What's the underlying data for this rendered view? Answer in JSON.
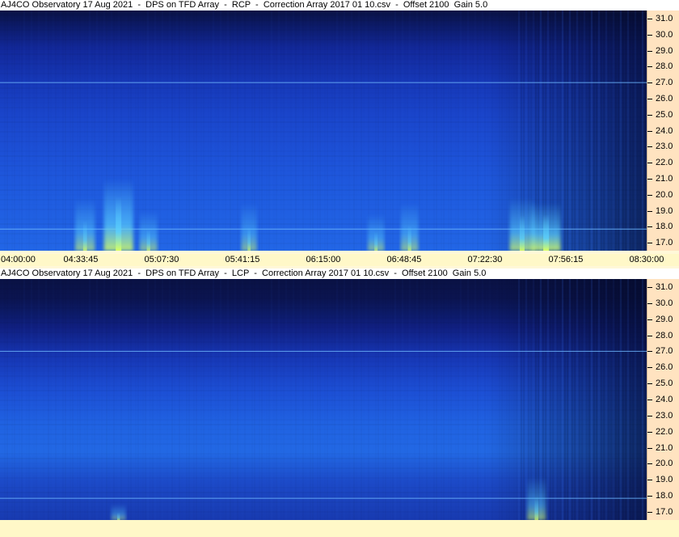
{
  "chart_data": [
    {
      "type": "heatmap",
      "title": "AJ4CO Observatory 17 Aug 2021  -  DPS on TFD Array  -  RCP  -  Correction Array 2017 01 10.csv  -  Offset 2100  Gain 5.0",
      "x_ticks": [
        "04:00:00",
        "04:33:45",
        "05:07:30",
        "05:41:15",
        "06:15:00",
        "06:48:45",
        "07:22:30",
        "07:56:15",
        "08:30:00"
      ],
      "y_ticks": [
        "31.0",
        "30.0",
        "29.0",
        "28.0",
        "27.0",
        "26.0",
        "25.0",
        "24.0",
        "23.0",
        "22.0",
        "21.0",
        "20.0",
        "19.0",
        "18.0",
        "17.0"
      ],
      "xlim": [
        "04:00:00",
        "08:30:00"
      ],
      "ylim": [
        16.5,
        31.5
      ],
      "bursts": [
        {
          "time": "04:35:30",
          "freq_low": 16.5,
          "freq_high": 19.8,
          "intensity": 0.55
        },
        {
          "time": "04:49:30",
          "freq_low": 16.5,
          "freq_high": 21.0,
          "intensity": 1.0
        },
        {
          "time": "05:02:00",
          "freq_low": 16.5,
          "freq_high": 19.0,
          "intensity": 0.45
        },
        {
          "time": "05:44:00",
          "freq_low": 16.5,
          "freq_high": 19.5,
          "intensity": 0.35
        },
        {
          "time": "06:37:00",
          "freq_low": 16.5,
          "freq_high": 18.8,
          "intensity": 0.4
        },
        {
          "time": "06:51:00",
          "freq_low": 16.5,
          "freq_high": 19.5,
          "intensity": 0.45
        },
        {
          "time": "07:38:00",
          "freq_low": 16.5,
          "freq_high": 19.8,
          "intensity": 0.8
        },
        {
          "time": "07:48:00",
          "freq_low": 16.5,
          "freq_high": 19.5,
          "intensity": 1.0
        }
      ],
      "interference_lines_mhz": [
        27.0,
        17.85
      ]
    },
    {
      "type": "heatmap",
      "title": "AJ4CO Observatory 17 Aug 2021  -  DPS on TFD Array  -  LCP  -  Correction Array 2017 01 10.csv  -  Offset 2100  Gain 5.0",
      "x_ticks": [],
      "y_ticks": [
        "31.0",
        "30.0",
        "29.0",
        "28.0",
        "27.0",
        "26.0",
        "25.0",
        "24.0",
        "23.0",
        "22.0",
        "21.0",
        "20.0",
        "19.0",
        "18.0",
        "17.0"
      ],
      "xlim": [
        "04:00:00",
        "08:30:00"
      ],
      "ylim": [
        16.5,
        31.5
      ],
      "bursts": [
        {
          "time": "04:49:30",
          "freq_low": 16.5,
          "freq_high": 17.5,
          "intensity": 0.3
        },
        {
          "time": "07:44:00",
          "freq_low": 16.5,
          "freq_high": 19.2,
          "intensity": 0.5
        }
      ],
      "interference_lines_mhz": [
        27.0,
        17.85
      ]
    }
  ],
  "colors": {
    "title_bg": "#ffffff",
    "axis_bg": "#ffe3c0",
    "time_axis_bg": "#fff8c8",
    "burst_core": "#d8ff60",
    "burst_glow": "#5ad0ff"
  }
}
